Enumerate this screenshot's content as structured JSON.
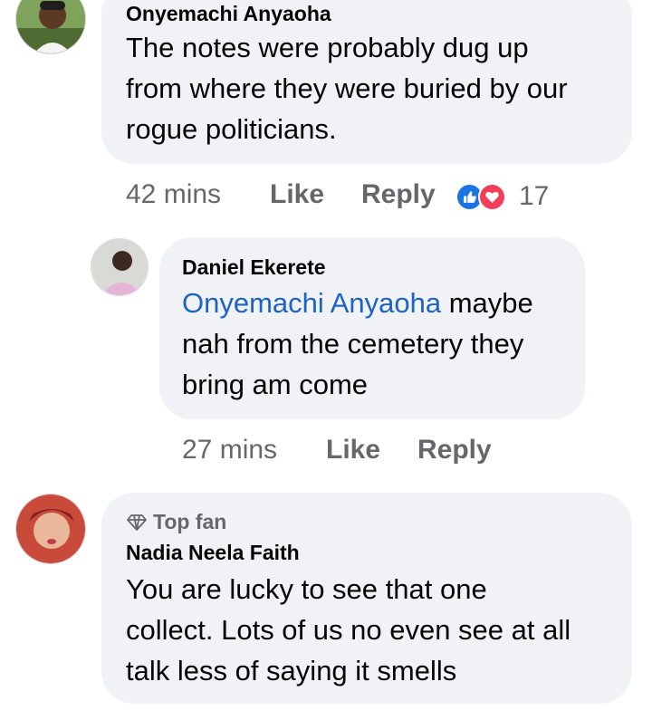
{
  "comments": [
    {
      "author": "Onyemachi Anyaoha",
      "lines": [
        "The notes were probably dug up",
        "from where they were buried by our",
        "rogue politicians."
      ],
      "time": "42 mins",
      "like_label": "Like",
      "reply_label": "Reply",
      "reaction_count": "17",
      "reactions": [
        "like-icon",
        "love-icon"
      ]
    },
    {
      "author": "Daniel Ekerete",
      "mention": "Onyemachi Anyaoha",
      "lines": [
        " maybe",
        "nah from the cemetery they",
        "bring am come"
      ],
      "time": "27 mins",
      "like_label": "Like",
      "reply_label": "Reply"
    },
    {
      "badge": "Top fan",
      "badge_icon": "diamond-icon",
      "author": "Nadia Neela Faith",
      "lines": [
        "You are lucky to see that one",
        "collect. Lots of us no even see at all",
        "talk less of saying it smells"
      ]
    }
  ],
  "colors": {
    "bubble": "#f0f2f5",
    "meta": "#65676b",
    "mention": "#1b63c4",
    "like_blue": "#1b74e4",
    "love_red": "#f33e58"
  }
}
